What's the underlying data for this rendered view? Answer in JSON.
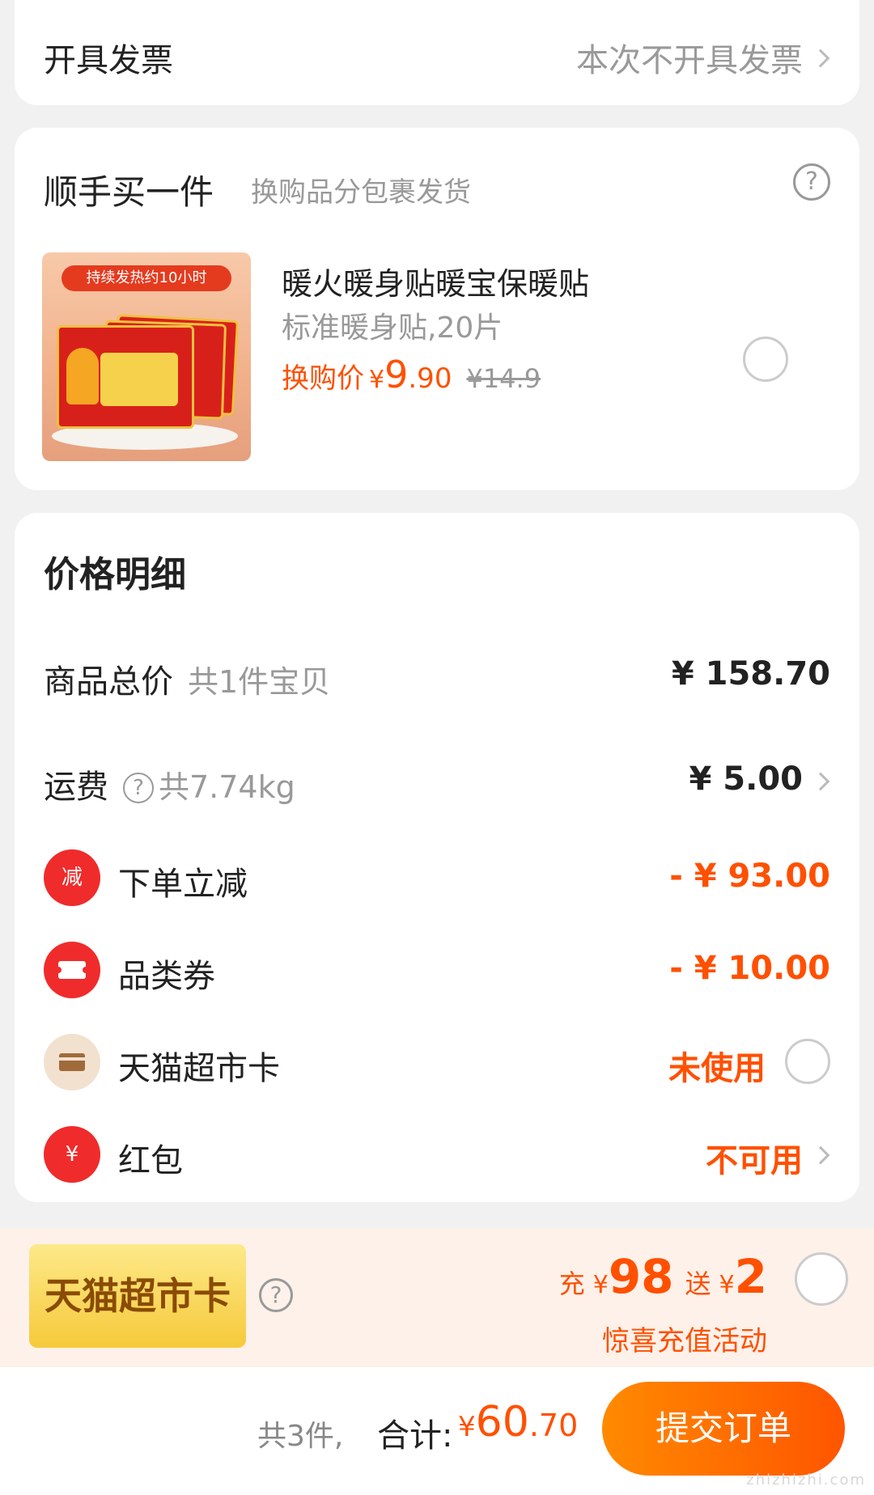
{
  "invoice": {
    "label": "开具发票",
    "value": "本次不开具发票"
  },
  "addon": {
    "title": "顺手买一件",
    "subtitle": "换购品分包裹发货",
    "help_icon": "?",
    "product": {
      "thumb_banner": "持续发热约10小时",
      "name": "暖火暖身贴暖宝保暖贴",
      "spec": "标准暖身贴,20片",
      "price_label": "换购价",
      "currency": "¥",
      "price_int": "9",
      "price_dec": ".90",
      "original_price": "¥14.9"
    }
  },
  "price_detail": {
    "title": "价格明细",
    "subtotal": {
      "label": "商品总价",
      "sub": "共1件宝贝",
      "value": "¥ 158.70"
    },
    "shipping": {
      "label": "运费",
      "help": "?",
      "sub": "共7.74kg",
      "value": "¥ 5.00"
    },
    "instant_discount": {
      "icon_text": "减",
      "label": "下单立减",
      "value": "- ¥ 93.00",
      "icon_color": "#f02b2b"
    },
    "category_coupon": {
      "label": "品类券",
      "value": "- ¥ 10.00",
      "icon_color": "#f02b2b"
    },
    "supermarket_card": {
      "label": "天猫超市卡",
      "value": "未使用",
      "icon_color": "#f3e1cf"
    },
    "red_packet": {
      "icon_text": "¥",
      "label": "红包",
      "value": "不可用",
      "icon_color": "#f02b2b"
    }
  },
  "promo": {
    "badge": "天猫超市卡",
    "help": "?",
    "charge_label": "充",
    "charge_cur": "¥",
    "charge_amount": "98",
    "gift_label": "送",
    "gift_cur": "¥",
    "gift_amount": "2",
    "subtitle": "惊喜充值活动"
  },
  "bottom": {
    "count": "共3件,",
    "total_label": "合计:",
    "currency": "¥",
    "total_int": "60",
    "total_dec": ".70",
    "submit": "提交订单",
    "watermark": "zhizhizhi.com"
  },
  "colors": {
    "accent": "#ff5000",
    "submit_gradient_start": "#ff8a00",
    "submit_gradient_end": "#ff5500"
  }
}
